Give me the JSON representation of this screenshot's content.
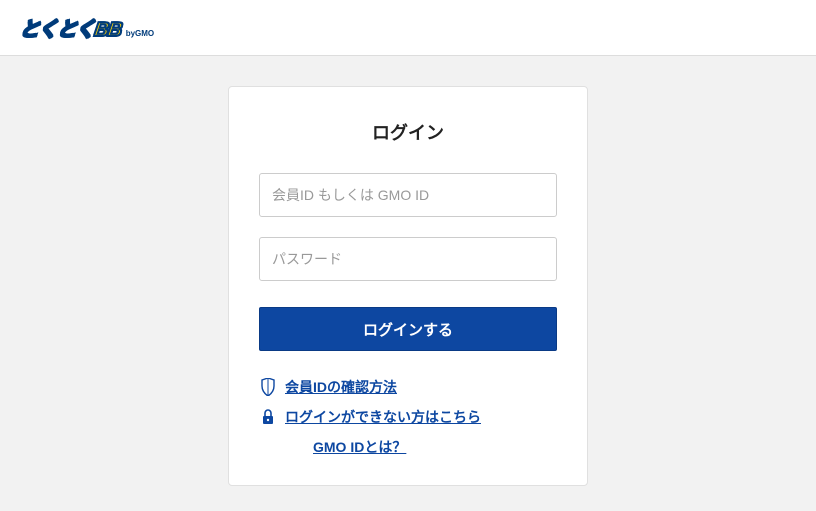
{
  "header": {
    "logo_text_1": "とくとく",
    "logo_text_2": "BB",
    "logo_sub": "byGMO"
  },
  "login": {
    "title": "ログイン",
    "id_placeholder": "会員ID もしくは GMO ID",
    "password_placeholder": "パスワード",
    "submit_label": "ログインする",
    "link_confirm_id": "会員IDの確認方法",
    "link_cannot_login": "ログインができない方はこちら",
    "link_gmoid": "GMO IDとは？"
  }
}
